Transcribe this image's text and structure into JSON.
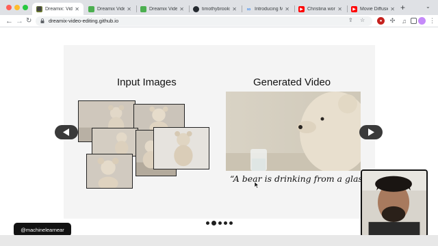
{
  "browser": {
    "tabs": [
      {
        "title": "Dreamix: Video",
        "favicon": "dreamix-icon",
        "color": "#6b7a2e",
        "active": true
      },
      {
        "title": "Dreamix Video",
        "favicon": "dreamix-icon",
        "color": "#4caf50",
        "active": false
      },
      {
        "title": "Dreamix Video",
        "favicon": "dreamix-icon",
        "color": "#4caf50",
        "active": false
      },
      {
        "title": "timothybrooks",
        "favicon": "github-icon",
        "color": "#24292f",
        "active": false
      },
      {
        "title": "Introducing Ma",
        "favicon": "meta-icon",
        "color": "#1877f2",
        "active": false
      },
      {
        "title": "Christina worki",
        "favicon": "youtube-icon",
        "color": "#ff0000",
        "active": false
      },
      {
        "title": "Movie Diffusion",
        "favicon": "youtube-icon",
        "color": "#ff0000",
        "active": false
      }
    ],
    "url": "dreamix-video-editing.github.io"
  },
  "slide": {
    "input_title": "Input Images",
    "output_title": "Generated Video",
    "caption": "“A bear is drinking from a glass”",
    "carousel_total": 5,
    "carousel_active": 2
  },
  "overlay": {
    "watermark": "@machinelearnear"
  },
  "colors": {
    "slide_bg": "#f4f4f4",
    "carousel_button": "#3a3a3a",
    "tabstrip": "#dfe1e5",
    "accent_blue": "#1a73e8"
  }
}
